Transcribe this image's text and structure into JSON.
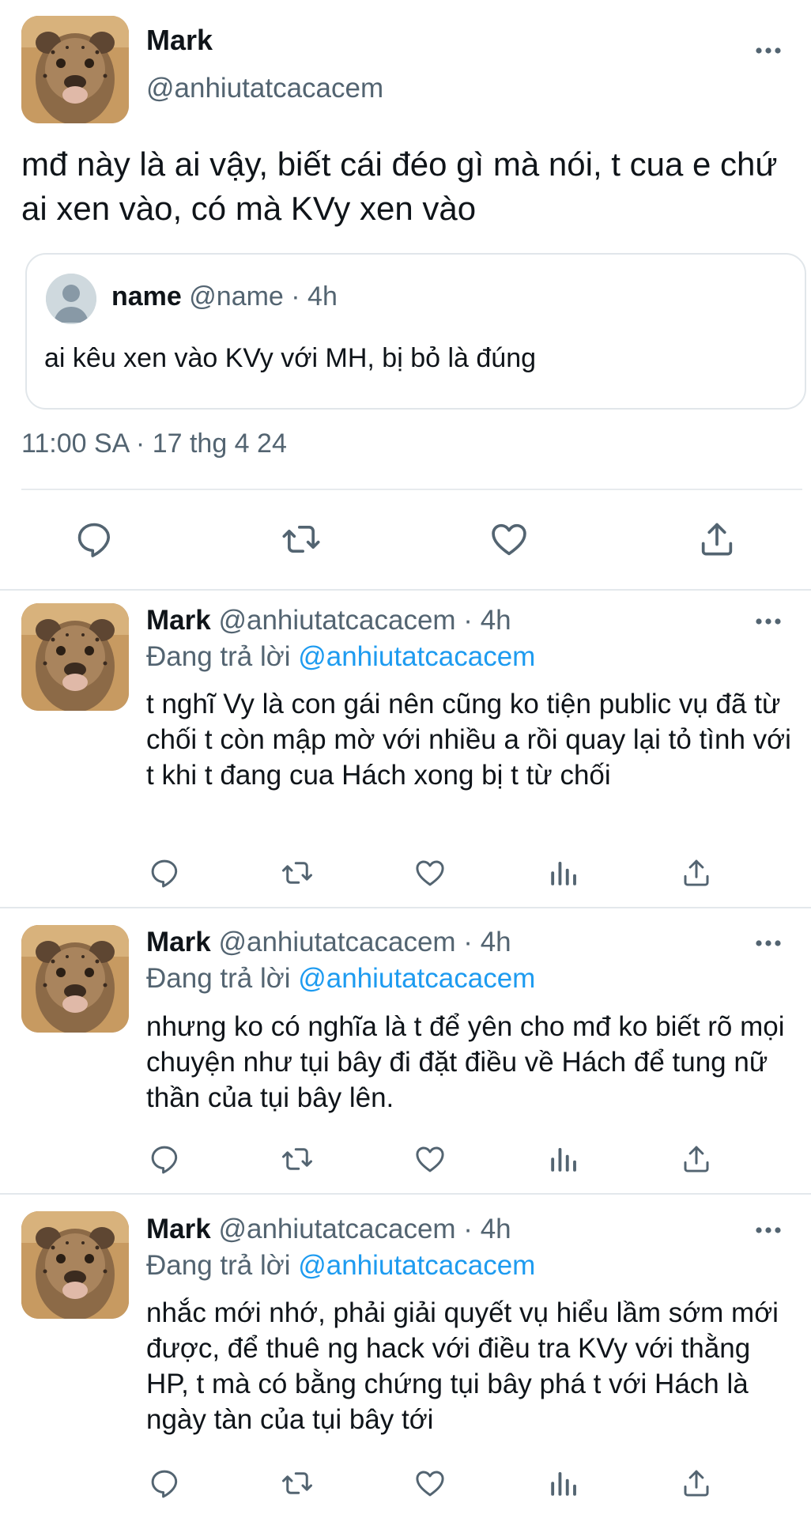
{
  "main_tweet": {
    "name": "Mark",
    "handle": "@anhiutatcacacem",
    "text": "mđ này là ai vậy, biết cái đéo gì mà nói, t cua e chứ ai xen vào, có mà KVy xen vào",
    "timestamp": "11:00 SA · 17 thg 4 24",
    "quote": {
      "name": "name",
      "meta": "@name · 4h",
      "text": "ai kêu xen vào KVy với MH, bị bỏ là đúng"
    }
  },
  "replies": [
    {
      "name": "Mark",
      "meta": "@anhiutatcacacem · 4h",
      "replying_prefix": "Đang trả lời ",
      "replying_to": "@anhiutatcacacem",
      "text": "t nghĩ Vy là con gái nên cũng ko tiện public vụ đã từ chối t còn mập mờ với nhiều a rồi quay lại tỏ tình với t khi t đang cua Hách xong bị t từ chối"
    },
    {
      "name": "Mark",
      "meta": "@anhiutatcacacem · 4h",
      "replying_prefix": "Đang trả lời ",
      "replying_to": "@anhiutatcacacem",
      "text": "nhưng ko có nghĩa là t để yên cho mđ ko biết rõ mọi chuyện như tụi bây đi đặt điều về Hách để tung nữ thần của tụi bây lên."
    },
    {
      "name": "Mark",
      "meta": "@anhiutatcacacem · 4h",
      "replying_prefix": "Đang trả lời ",
      "replying_to": "@anhiutatcacacem",
      "text": "nhắc mới nhớ, phải giải quyết vụ hiểu lầm sớm mới được, để thuê ng hack với điều tra KVy với thằng HP, t mà có bằng chứng tụi bây phá t với Hách là ngày tàn của tụi bây tới"
    }
  ],
  "colors": {
    "text": "#0f1419",
    "secondary": "#536471",
    "link": "#1d9bf0",
    "divider": "#e7ebee"
  },
  "icons": [
    "more-icon",
    "reply-icon",
    "retweet-icon",
    "like-icon",
    "share-icon",
    "analytics-icon"
  ]
}
